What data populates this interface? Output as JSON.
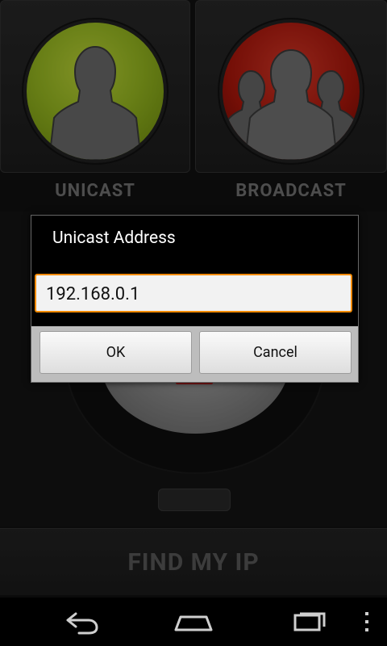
{
  "tiles": {
    "unicast_label": "UNICAST",
    "broadcast_label": "BROADCAST"
  },
  "main": {
    "find_button_label": "FIND MY IP"
  },
  "dialog": {
    "title": "Unicast Address",
    "input_value": "192.168.0.1",
    "ok_label": "OK",
    "cancel_label": "Cancel"
  },
  "nav": {
    "back_icon": "back-icon",
    "home_icon": "home-icon",
    "recent_icon": "recent-apps-icon",
    "menu_icon": "overflow-menu-icon"
  },
  "colors": {
    "unicast_accent": "#9fc222",
    "broadcast_accent": "#b3170b",
    "input_focus_border": "#f28a00"
  }
}
